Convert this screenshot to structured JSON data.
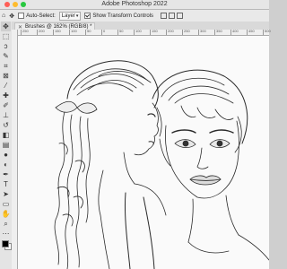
{
  "app": {
    "title": "Adobe Photoshop 2022"
  },
  "window_controls": {
    "close_color": "#ff5f57",
    "minimize_color": "#febc2e",
    "zoom_color": "#28c840"
  },
  "options_bar": {
    "auto_select_label": "Auto-Select:",
    "auto_select_checked": false,
    "layer_select_value": "Layer",
    "transform_label": "Show Transform Controls",
    "transform_checked": true
  },
  "document_tab": {
    "close_glyph": "✕",
    "label": "Brushes @ 162% (RGB/8) *"
  },
  "toolbar": {
    "tools": [
      {
        "icon": "move-icon",
        "glyph": "✥"
      },
      {
        "icon": "marquee-icon",
        "glyph": "⬚"
      },
      {
        "icon": "lasso-icon",
        "glyph": "ↄ"
      },
      {
        "icon": "quick-select-icon",
        "glyph": "✎"
      },
      {
        "icon": "crop-icon",
        "glyph": "⌗"
      },
      {
        "icon": "frame-icon",
        "glyph": "⊠"
      },
      {
        "icon": "eyedropper-icon",
        "glyph": "⁄"
      },
      {
        "icon": "healing-brush-icon",
        "glyph": "✚"
      },
      {
        "icon": "brush-icon",
        "glyph": "✐"
      },
      {
        "icon": "clone-stamp-icon",
        "glyph": "⊥"
      },
      {
        "icon": "history-brush-icon",
        "glyph": "↺"
      },
      {
        "icon": "eraser-icon",
        "glyph": "◧"
      },
      {
        "icon": "gradient-icon",
        "glyph": "▤"
      },
      {
        "icon": "blur-icon",
        "glyph": "●"
      },
      {
        "icon": "dodge-icon",
        "glyph": "◐"
      },
      {
        "icon": "pen-icon",
        "glyph": "✒"
      },
      {
        "icon": "type-icon",
        "glyph": "T"
      },
      {
        "icon": "path-select-icon",
        "glyph": "➤"
      },
      {
        "icon": "rectangle-icon",
        "glyph": "▭"
      },
      {
        "icon": "hand-icon",
        "glyph": "✋"
      },
      {
        "icon": "zoom-icon",
        "glyph": "⌕"
      },
      {
        "icon": "more-tools-icon",
        "glyph": "⋯"
      }
    ],
    "foreground_color": "#000000",
    "background_color": "#ffffff"
  },
  "ruler": {
    "labels": [
      "250",
      "200",
      "150",
      "100",
      "50",
      "0",
      "50",
      "100",
      "150",
      "200",
      "250",
      "300",
      "350",
      "400",
      "450",
      "500"
    ]
  }
}
